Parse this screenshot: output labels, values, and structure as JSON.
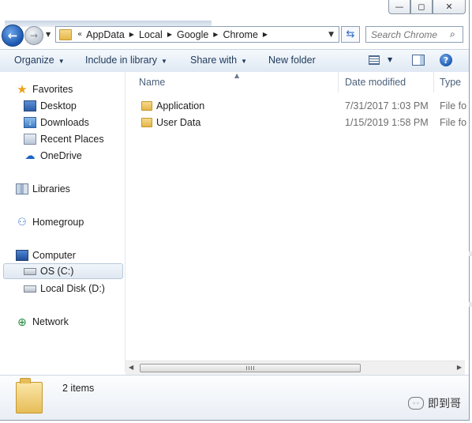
{
  "window": {
    "caption_buttons": {
      "minimize": "—",
      "maximize": "◻",
      "close": "✕"
    }
  },
  "address": {
    "overflow": "«",
    "crumbs": [
      "AppData",
      "Local",
      "Google",
      "Chrome"
    ],
    "search_placeholder": "Search Chrome"
  },
  "commands": {
    "organize": "Organize",
    "include": "Include in library",
    "share": "Share with",
    "new_folder": "New folder",
    "help": "?"
  },
  "nav": {
    "favorites": "Favorites",
    "desktop": "Desktop",
    "downloads": "Downloads",
    "recent": "Recent Places",
    "onedrive": "OneDrive",
    "libraries": "Libraries",
    "homegroup": "Homegroup",
    "computer": "Computer",
    "drive_c": "OS (C:)",
    "drive_d": "Local Disk (D:)",
    "network": "Network"
  },
  "columns": {
    "name": "Name",
    "date": "Date modified",
    "type": "Type"
  },
  "files": [
    {
      "name": "Application",
      "date": "7/31/2017 1:03 PM",
      "type": "File fo"
    },
    {
      "name": "User Data",
      "date": "1/15/2019 1:58 PM",
      "type": "File fo"
    }
  ],
  "status": {
    "count": "2 items"
  },
  "watermark": "即到哥",
  "icons": [
    "back-arrow-icon",
    "forward-arrow-icon",
    "folder-icon",
    "refresh-icon",
    "search-icon",
    "view-icon",
    "preview-pane-icon",
    "help-icon",
    "star-icon",
    "desktop-icon",
    "downloads-icon",
    "recent-places-icon",
    "onedrive-icon",
    "libraries-icon",
    "homegroup-icon",
    "computer-icon",
    "drive-icon",
    "network-icon"
  ]
}
